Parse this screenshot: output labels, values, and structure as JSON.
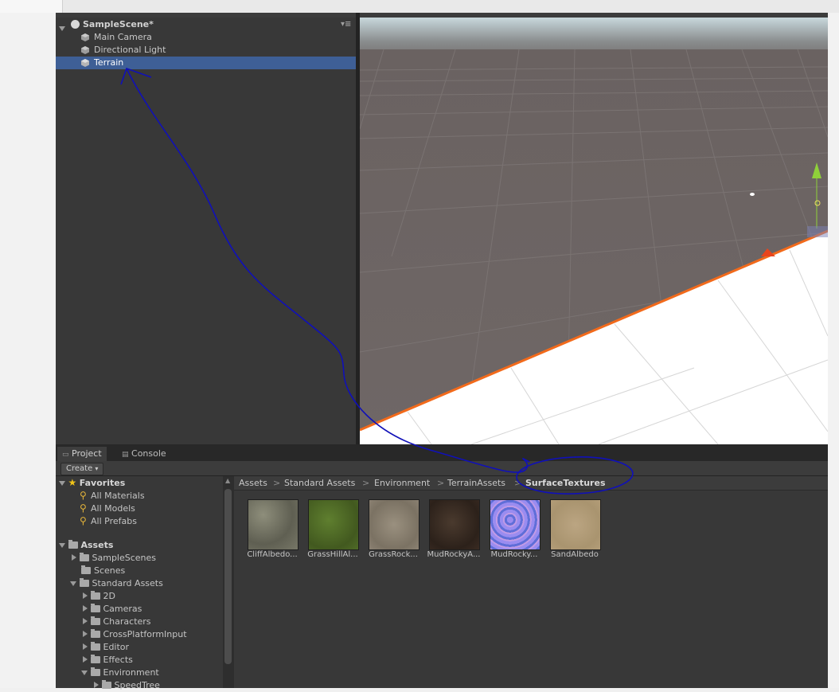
{
  "hierarchy": {
    "scene_name": "SampleScene*",
    "items": [
      {
        "label": "Main Camera"
      },
      {
        "label": "Directional Light"
      },
      {
        "label": "Terrain",
        "selected": true
      }
    ]
  },
  "lower_panel": {
    "tabs": [
      {
        "label": "Project",
        "active": true
      },
      {
        "label": "Console",
        "active": false
      }
    ],
    "create_label": "Create"
  },
  "tree": {
    "favorites_label": "Favorites",
    "favorites": [
      "All Materials",
      "All Models",
      "All Prefabs"
    ],
    "assets_label": "Assets",
    "assets_children": [
      "SampleScenes",
      "Scenes",
      "Standard Assets"
    ],
    "standard_children": [
      "2D",
      "Cameras",
      "Characters",
      "CrossPlatformInput",
      "Editor",
      "Effects",
      "Environment"
    ],
    "environment_children": [
      "SpeedTree"
    ]
  },
  "breadcrumb": [
    "Assets",
    "Standard Assets",
    "Environment",
    "TerrainAssets",
    "SurfaceTextures"
  ],
  "breadcrumb_separator": ">",
  "textures": [
    {
      "label": "CliffAlbedo...",
      "color": "#777767"
    },
    {
      "label": "GrassHillAl...",
      "color": "#4f6b27"
    },
    {
      "label": "GrassRock...",
      "color": "#8b8172"
    },
    {
      "label": "MudRockyA...",
      "color": "#3a2b22"
    },
    {
      "label": "MudRocky...",
      "color": "#8a7ae0"
    },
    {
      "label": "SandAlbedo",
      "color": "#b39d78"
    }
  ],
  "colors": {
    "selection": "#3e5f96",
    "annotation": "#1010b8",
    "terrain_outline": "#f26a1b"
  }
}
